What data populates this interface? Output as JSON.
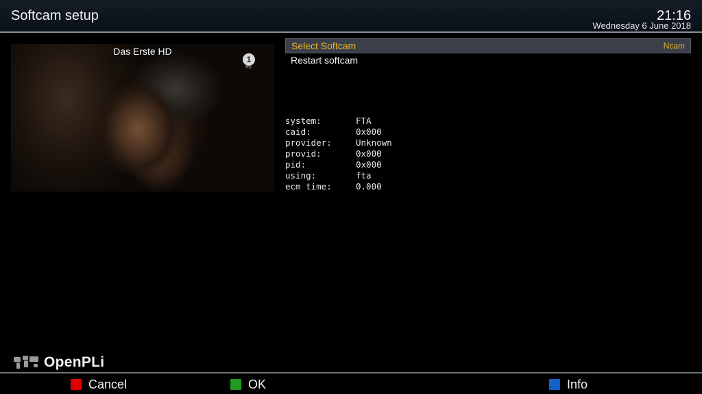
{
  "header": {
    "title": "Softcam setup",
    "time": "21:16",
    "date": "Wednesday  6 June 2018"
  },
  "preview": {
    "channel_name": "Das Erste HD",
    "channel_logo": "1",
    "channel_logo_sub": "HD"
  },
  "menu": {
    "items": [
      {
        "label": "Select Softcam",
        "value": "Ncam",
        "selected": true
      },
      {
        "label": "Restart softcam",
        "value": "",
        "selected": false
      }
    ]
  },
  "info": {
    "rows": [
      {
        "key": "system:",
        "value": "FTA"
      },
      {
        "key": "caid:",
        "value": "0x000"
      },
      {
        "key": "provider:",
        "value": "Unknown"
      },
      {
        "key": "provid:",
        "value": "0x000"
      },
      {
        "key": "pid:",
        "value": "0x000"
      },
      {
        "key": "using:",
        "value": "fta"
      },
      {
        "key": "ecm time:",
        "value": "0.000"
      }
    ]
  },
  "branding": {
    "logo_text": "OpenPLi",
    "logo_icon": "world-map-icon"
  },
  "footer": {
    "buttons": [
      {
        "label": "Cancel",
        "color": "#e00000",
        "icon": "red-key-icon"
      },
      {
        "label": "OK",
        "color": "#1f9a1f",
        "icon": "green-key-icon"
      },
      {
        "label": "Info",
        "color": "#1560c8",
        "icon": "blue-key-icon"
      }
    ]
  },
  "colors": {
    "selected_text": "#f0b62a",
    "selected_background": "#3a3f4a"
  }
}
